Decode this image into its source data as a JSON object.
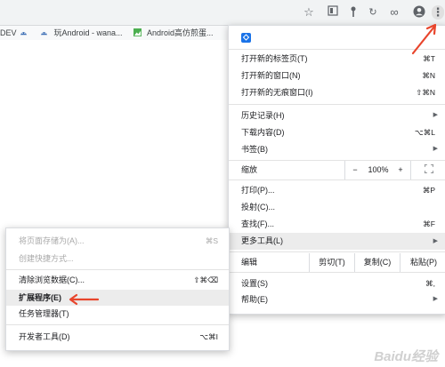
{
  "colors": {
    "accent": "#1a73e8",
    "annotation": "#e8452c"
  },
  "bookmarks": [
    {
      "label": "DEV",
      "icon": "android-icon"
    },
    {
      "label": "",
      "icon": "android-icon"
    },
    {
      "label": "玩Android - wana...",
      "icon": "android-icon"
    },
    {
      "label": "Android高仿煎蛋...",
      "icon": "image-icon"
    }
  ],
  "toolbar_icons": [
    "star-icon",
    "bookmark-list-icon",
    "plugin-icon",
    "reload-icon",
    "infinity-icon",
    "account-icon",
    "more-vert-icon"
  ],
  "menu": {
    "items": [
      {
        "label": "打开新的标签页(T)",
        "shortcut": "⌘T"
      },
      {
        "label": "打开新的窗口(N)",
        "shortcut": "⌘N"
      },
      {
        "label": "打开新的无痕窗口(I)",
        "shortcut": "⇧⌘N"
      },
      {
        "label": "历史记录(H)",
        "shortcut": ""
      },
      {
        "label": "下载内容(D)",
        "shortcut": "⌥⌘L"
      },
      {
        "label": "书签(B)",
        "shortcut": ""
      },
      {
        "label": "打印(P)...",
        "shortcut": "⌘P"
      },
      {
        "label": "投射(C)...",
        "shortcut": ""
      },
      {
        "label": "查找(F)...",
        "shortcut": "⌘F"
      },
      {
        "label": "更多工具(L)",
        "shortcut": ""
      },
      {
        "label": "设置(S)",
        "shortcut": "⌘,"
      },
      {
        "label": "帮助(E)",
        "shortcut": ""
      }
    ],
    "zoom": {
      "label": "缩放",
      "minus": "−",
      "value": "100%",
      "plus": "+"
    },
    "edit": {
      "label": "编辑",
      "cut": "剪切(T)",
      "copy": "复制(C)",
      "paste": "粘贴(P)"
    }
  },
  "submenu": {
    "items": [
      {
        "label": "将页面存储为(A)...",
        "shortcut": "⌘S"
      },
      {
        "label": "创建快捷方式...",
        "shortcut": ""
      },
      {
        "label": "清除浏览数据(C)...",
        "shortcut": "⇧⌘⌫"
      },
      {
        "label": "扩展程序(E)",
        "shortcut": ""
      },
      {
        "label": "任务管理器(T)",
        "shortcut": ""
      },
      {
        "label": "开发者工具(D)",
        "shortcut": "⌥⌘I"
      }
    ]
  },
  "watermark": "Baidu经验"
}
